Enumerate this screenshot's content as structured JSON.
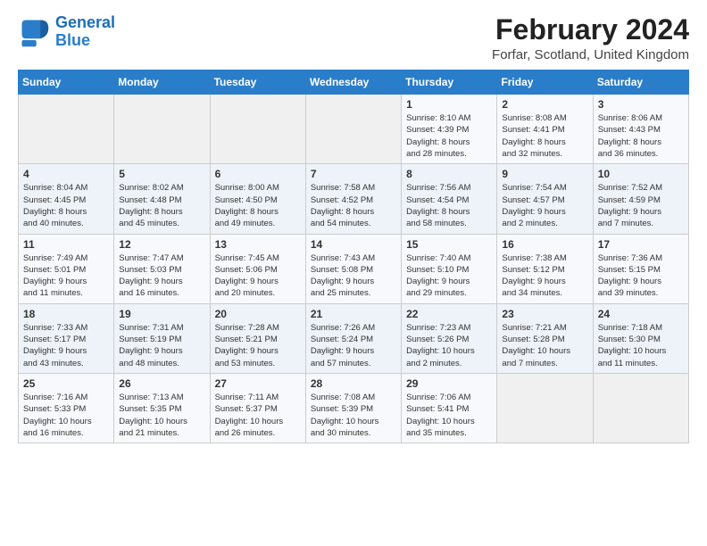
{
  "logo": {
    "text_general": "General",
    "text_blue": "Blue"
  },
  "title": "February 2024",
  "subtitle": "Forfar, Scotland, United Kingdom",
  "weekdays": [
    "Sunday",
    "Monday",
    "Tuesday",
    "Wednesday",
    "Thursday",
    "Friday",
    "Saturday"
  ],
  "weeks": [
    [
      {
        "day": "",
        "info": ""
      },
      {
        "day": "",
        "info": ""
      },
      {
        "day": "",
        "info": ""
      },
      {
        "day": "",
        "info": ""
      },
      {
        "day": "1",
        "info": "Sunrise: 8:10 AM\nSunset: 4:39 PM\nDaylight: 8 hours\nand 28 minutes."
      },
      {
        "day": "2",
        "info": "Sunrise: 8:08 AM\nSunset: 4:41 PM\nDaylight: 8 hours\nand 32 minutes."
      },
      {
        "day": "3",
        "info": "Sunrise: 8:06 AM\nSunset: 4:43 PM\nDaylight: 8 hours\nand 36 minutes."
      }
    ],
    [
      {
        "day": "4",
        "info": "Sunrise: 8:04 AM\nSunset: 4:45 PM\nDaylight: 8 hours\nand 40 minutes."
      },
      {
        "day": "5",
        "info": "Sunrise: 8:02 AM\nSunset: 4:48 PM\nDaylight: 8 hours\nand 45 minutes."
      },
      {
        "day": "6",
        "info": "Sunrise: 8:00 AM\nSunset: 4:50 PM\nDaylight: 8 hours\nand 49 minutes."
      },
      {
        "day": "7",
        "info": "Sunrise: 7:58 AM\nSunset: 4:52 PM\nDaylight: 8 hours\nand 54 minutes."
      },
      {
        "day": "8",
        "info": "Sunrise: 7:56 AM\nSunset: 4:54 PM\nDaylight: 8 hours\nand 58 minutes."
      },
      {
        "day": "9",
        "info": "Sunrise: 7:54 AM\nSunset: 4:57 PM\nDaylight: 9 hours\nand 2 minutes."
      },
      {
        "day": "10",
        "info": "Sunrise: 7:52 AM\nSunset: 4:59 PM\nDaylight: 9 hours\nand 7 minutes."
      }
    ],
    [
      {
        "day": "11",
        "info": "Sunrise: 7:49 AM\nSunset: 5:01 PM\nDaylight: 9 hours\nand 11 minutes."
      },
      {
        "day": "12",
        "info": "Sunrise: 7:47 AM\nSunset: 5:03 PM\nDaylight: 9 hours\nand 16 minutes."
      },
      {
        "day": "13",
        "info": "Sunrise: 7:45 AM\nSunset: 5:06 PM\nDaylight: 9 hours\nand 20 minutes."
      },
      {
        "day": "14",
        "info": "Sunrise: 7:43 AM\nSunset: 5:08 PM\nDaylight: 9 hours\nand 25 minutes."
      },
      {
        "day": "15",
        "info": "Sunrise: 7:40 AM\nSunset: 5:10 PM\nDaylight: 9 hours\nand 29 minutes."
      },
      {
        "day": "16",
        "info": "Sunrise: 7:38 AM\nSunset: 5:12 PM\nDaylight: 9 hours\nand 34 minutes."
      },
      {
        "day": "17",
        "info": "Sunrise: 7:36 AM\nSunset: 5:15 PM\nDaylight: 9 hours\nand 39 minutes."
      }
    ],
    [
      {
        "day": "18",
        "info": "Sunrise: 7:33 AM\nSunset: 5:17 PM\nDaylight: 9 hours\nand 43 minutes."
      },
      {
        "day": "19",
        "info": "Sunrise: 7:31 AM\nSunset: 5:19 PM\nDaylight: 9 hours\nand 48 minutes."
      },
      {
        "day": "20",
        "info": "Sunrise: 7:28 AM\nSunset: 5:21 PM\nDaylight: 9 hours\nand 53 minutes."
      },
      {
        "day": "21",
        "info": "Sunrise: 7:26 AM\nSunset: 5:24 PM\nDaylight: 9 hours\nand 57 minutes."
      },
      {
        "day": "22",
        "info": "Sunrise: 7:23 AM\nSunset: 5:26 PM\nDaylight: 10 hours\nand 2 minutes."
      },
      {
        "day": "23",
        "info": "Sunrise: 7:21 AM\nSunset: 5:28 PM\nDaylight: 10 hours\nand 7 minutes."
      },
      {
        "day": "24",
        "info": "Sunrise: 7:18 AM\nSunset: 5:30 PM\nDaylight: 10 hours\nand 11 minutes."
      }
    ],
    [
      {
        "day": "25",
        "info": "Sunrise: 7:16 AM\nSunset: 5:33 PM\nDaylight: 10 hours\nand 16 minutes."
      },
      {
        "day": "26",
        "info": "Sunrise: 7:13 AM\nSunset: 5:35 PM\nDaylight: 10 hours\nand 21 minutes."
      },
      {
        "day": "27",
        "info": "Sunrise: 7:11 AM\nSunset: 5:37 PM\nDaylight: 10 hours\nand 26 minutes."
      },
      {
        "day": "28",
        "info": "Sunrise: 7:08 AM\nSunset: 5:39 PM\nDaylight: 10 hours\nand 30 minutes."
      },
      {
        "day": "29",
        "info": "Sunrise: 7:06 AM\nSunset: 5:41 PM\nDaylight: 10 hours\nand 35 minutes."
      },
      {
        "day": "",
        "info": ""
      },
      {
        "day": "",
        "info": ""
      }
    ]
  ]
}
